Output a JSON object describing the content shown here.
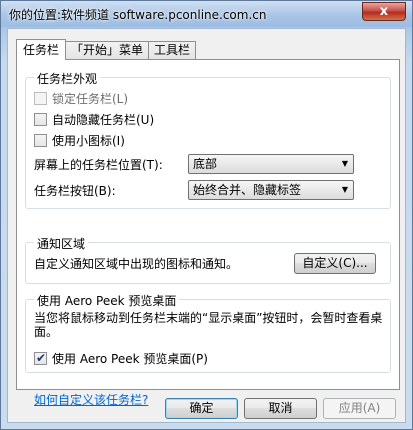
{
  "window": {
    "title": "你的位置:软件频道 software.pconline.com.cn",
    "close_label": "x"
  },
  "tabs": [
    {
      "label": "任务栏"
    },
    {
      "label": "「开始」菜单"
    },
    {
      "label": "工具栏"
    }
  ],
  "appearance": {
    "title": "任务栏外观",
    "lock_taskbar": {
      "label": "锁定任务栏(L)",
      "checked": false
    },
    "auto_hide": {
      "label": "自动隐藏任务栏(U)",
      "checked": false
    },
    "small_icons": {
      "label": "使用小图标(I)",
      "checked": false
    },
    "position_label": "屏幕上的任务栏位置(T):",
    "position_value": "底部",
    "buttons_label": "任务栏按钮(B):",
    "buttons_value": "始终合并、隐藏标签"
  },
  "notification": {
    "title": "通知区域",
    "description": "自定义通知区域中出现的图标和通知。",
    "customize_button": "自定义(C)..."
  },
  "aero_peek": {
    "title": "使用 Aero Peek 预览桌面",
    "description": "当您将鼠标移动到任务栏末端的“显示桌面”按钮时，会暂时查看桌面。",
    "checkbox_label": "使用 Aero Peek 预览桌面(P)",
    "checked": true
  },
  "help_link": "如何自定义该任务栏?",
  "footer": {
    "ok": "确定",
    "cancel": "取消",
    "apply": "应用(A)"
  },
  "colors": {
    "title_bar": "#a8c4e5",
    "link": "#0066cc"
  }
}
